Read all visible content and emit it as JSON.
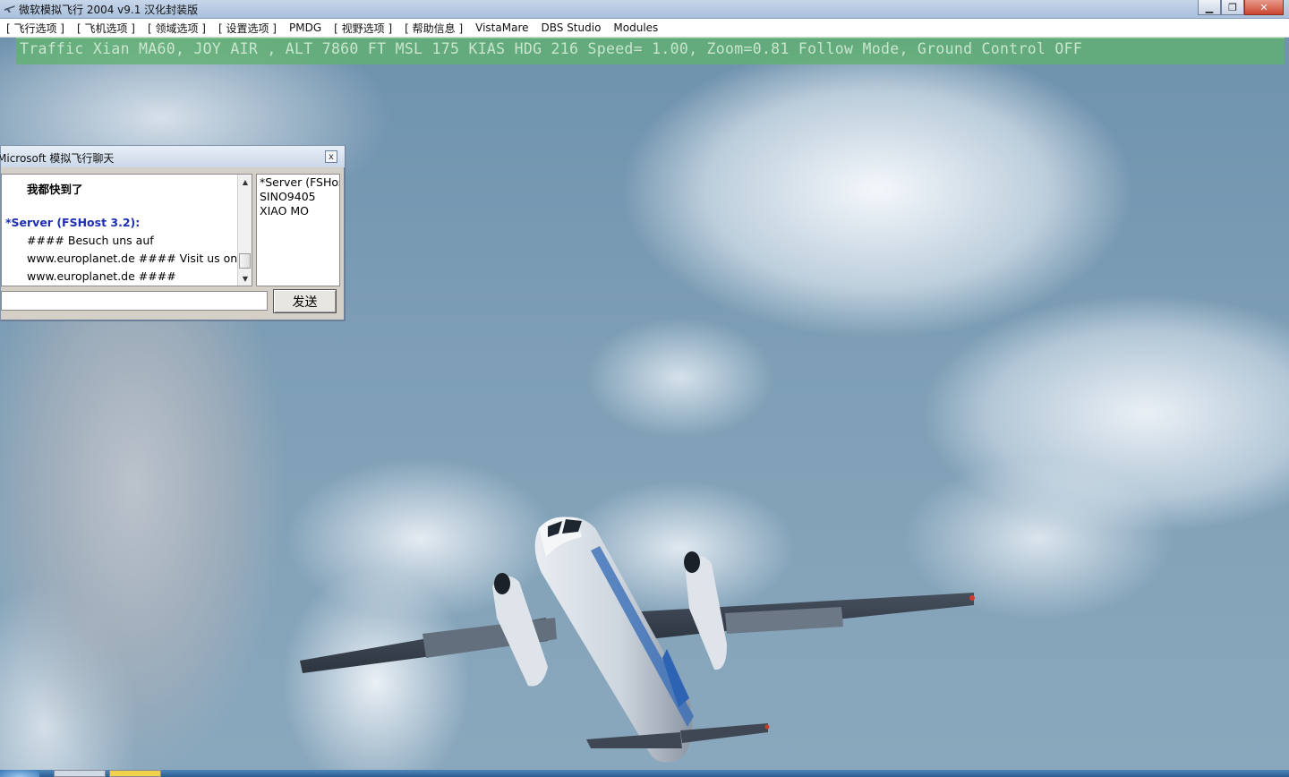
{
  "window": {
    "title": "微软模拟飞行 2004 v9.1 汉化封装版",
    "minimize_symbol": "▁",
    "maximize_symbol": "❐",
    "close_symbol": "✕"
  },
  "menu": [
    "[ 飞行选项 ]",
    "[ 飞机选项 ]",
    "[ 领域选项 ]",
    "[ 设置选项 ]",
    "PMDG",
    "[ 视野选项 ]",
    "[ 帮助信息 ]",
    "VistaMare",
    "DBS Studio",
    "Modules"
  ],
  "status_banner": "Traffic Xian MA60, JOY AIR , ALT 7860 FT MSL  175 KIAS  HDG 216 Speed= 1.00, Zoom=0.81 Follow Mode, Ground Control OFF",
  "chat": {
    "title": "Microsoft 模拟飞行聊天",
    "close_symbol": "x",
    "messages": [
      {
        "text": "我都快到了",
        "style": "bold"
      },
      {
        "text": "*Server (FSHost 3.2):",
        "style": "server"
      },
      {
        "text": "#### Besuch uns auf",
        "style": "normal"
      },
      {
        "text": "www.europlanet.de #### Visit us on",
        "style": "normal"
      },
      {
        "text": "www.europlanet.de ####",
        "style": "normal"
      }
    ],
    "users": [
      "*Server (FSHost",
      "SINO9405",
      "XIAO MO"
    ],
    "input_value": "",
    "send_label": "发送"
  },
  "scene": {
    "aircraft": "Xian MA60",
    "sky_color": "#7e9fb6",
    "banner_color": "#60b26e"
  }
}
